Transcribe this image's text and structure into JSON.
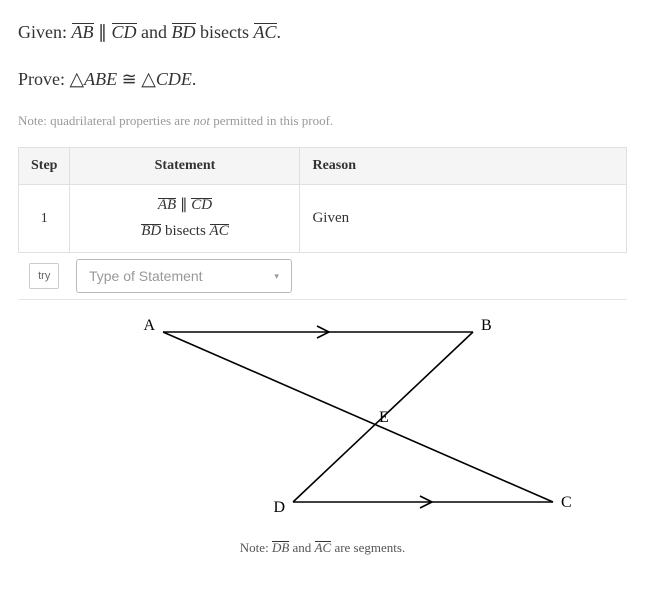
{
  "given": {
    "prefix": "Given: ",
    "seg1": "AB",
    "parallel": " ∥ ",
    "seg2": "CD",
    "and": " and ",
    "seg3": "BD",
    "mid": " bisects ",
    "seg4": "AC",
    "dot": "."
  },
  "prove": {
    "prefix": "Prove: ",
    "tri1": "△",
    "t1": "ABE",
    "cong": " ≅  ",
    "tri2": "△",
    "t2": "CDE",
    "dot": "."
  },
  "note_line": {
    "a": "Note: quadrilateral properties are ",
    "b": "not",
    "c": " permitted in this proof."
  },
  "table": {
    "headers": {
      "step": "Step",
      "statement": "Statement",
      "reason": "Reason"
    },
    "rows": [
      {
        "step": "1",
        "stmt_l1_a": "AB",
        "stmt_l1_b": " ∥ ",
        "stmt_l1_c": "CD",
        "stmt_l2_a": "BD",
        "stmt_l2_b": " bisects ",
        "stmt_l2_c": "AC",
        "reason": "Given"
      }
    ],
    "try_label": "try",
    "type_placeholder": "Type of Statement"
  },
  "diagram": {
    "pts": {
      "A": "A",
      "B": "B",
      "C": "C",
      "D": "D",
      "E": "E"
    }
  },
  "diagram_note": {
    "a": "Note: ",
    "s1": "DB",
    "b": " and ",
    "s2": "AC",
    "c": " are segments."
  }
}
